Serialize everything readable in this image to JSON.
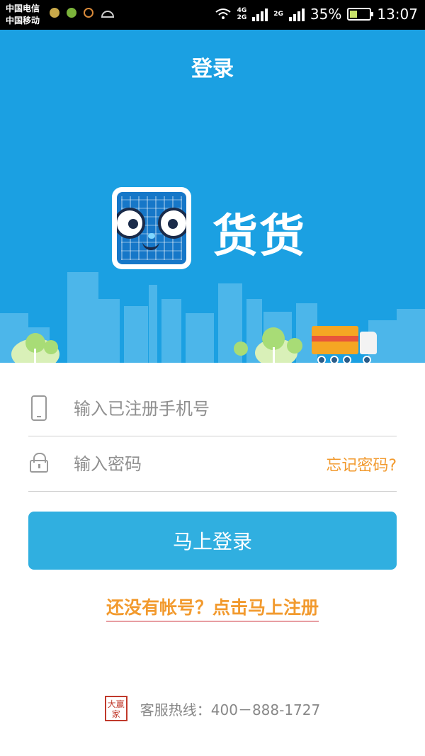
{
  "status_bar": {
    "carrier_1": "中国电信",
    "carrier_2": "中国移动",
    "net_1": "4G",
    "net_2": "2G",
    "net_3": "2G",
    "battery": "35%",
    "time": "13:07"
  },
  "header": {
    "title": "登录"
  },
  "brand": {
    "name": "货货"
  },
  "form": {
    "phone_placeholder": "输入已注册手机号",
    "password_placeholder": "输入密码",
    "forgot_label": "忘记密码?"
  },
  "actions": {
    "login_label": "马上登录",
    "register_label": "还没有帐号？点击马上注册"
  },
  "footer": {
    "logo_text": "大赢家",
    "hotline": "客服热线：400－888-1727"
  },
  "colors": {
    "header_bg": "#1ba0e2",
    "button_bg": "#30afe0",
    "accent_orange": "#f29a2e"
  },
  "icons": [
    "phone-icon",
    "lock-icon",
    "wifi-icon",
    "battery-icon"
  ]
}
